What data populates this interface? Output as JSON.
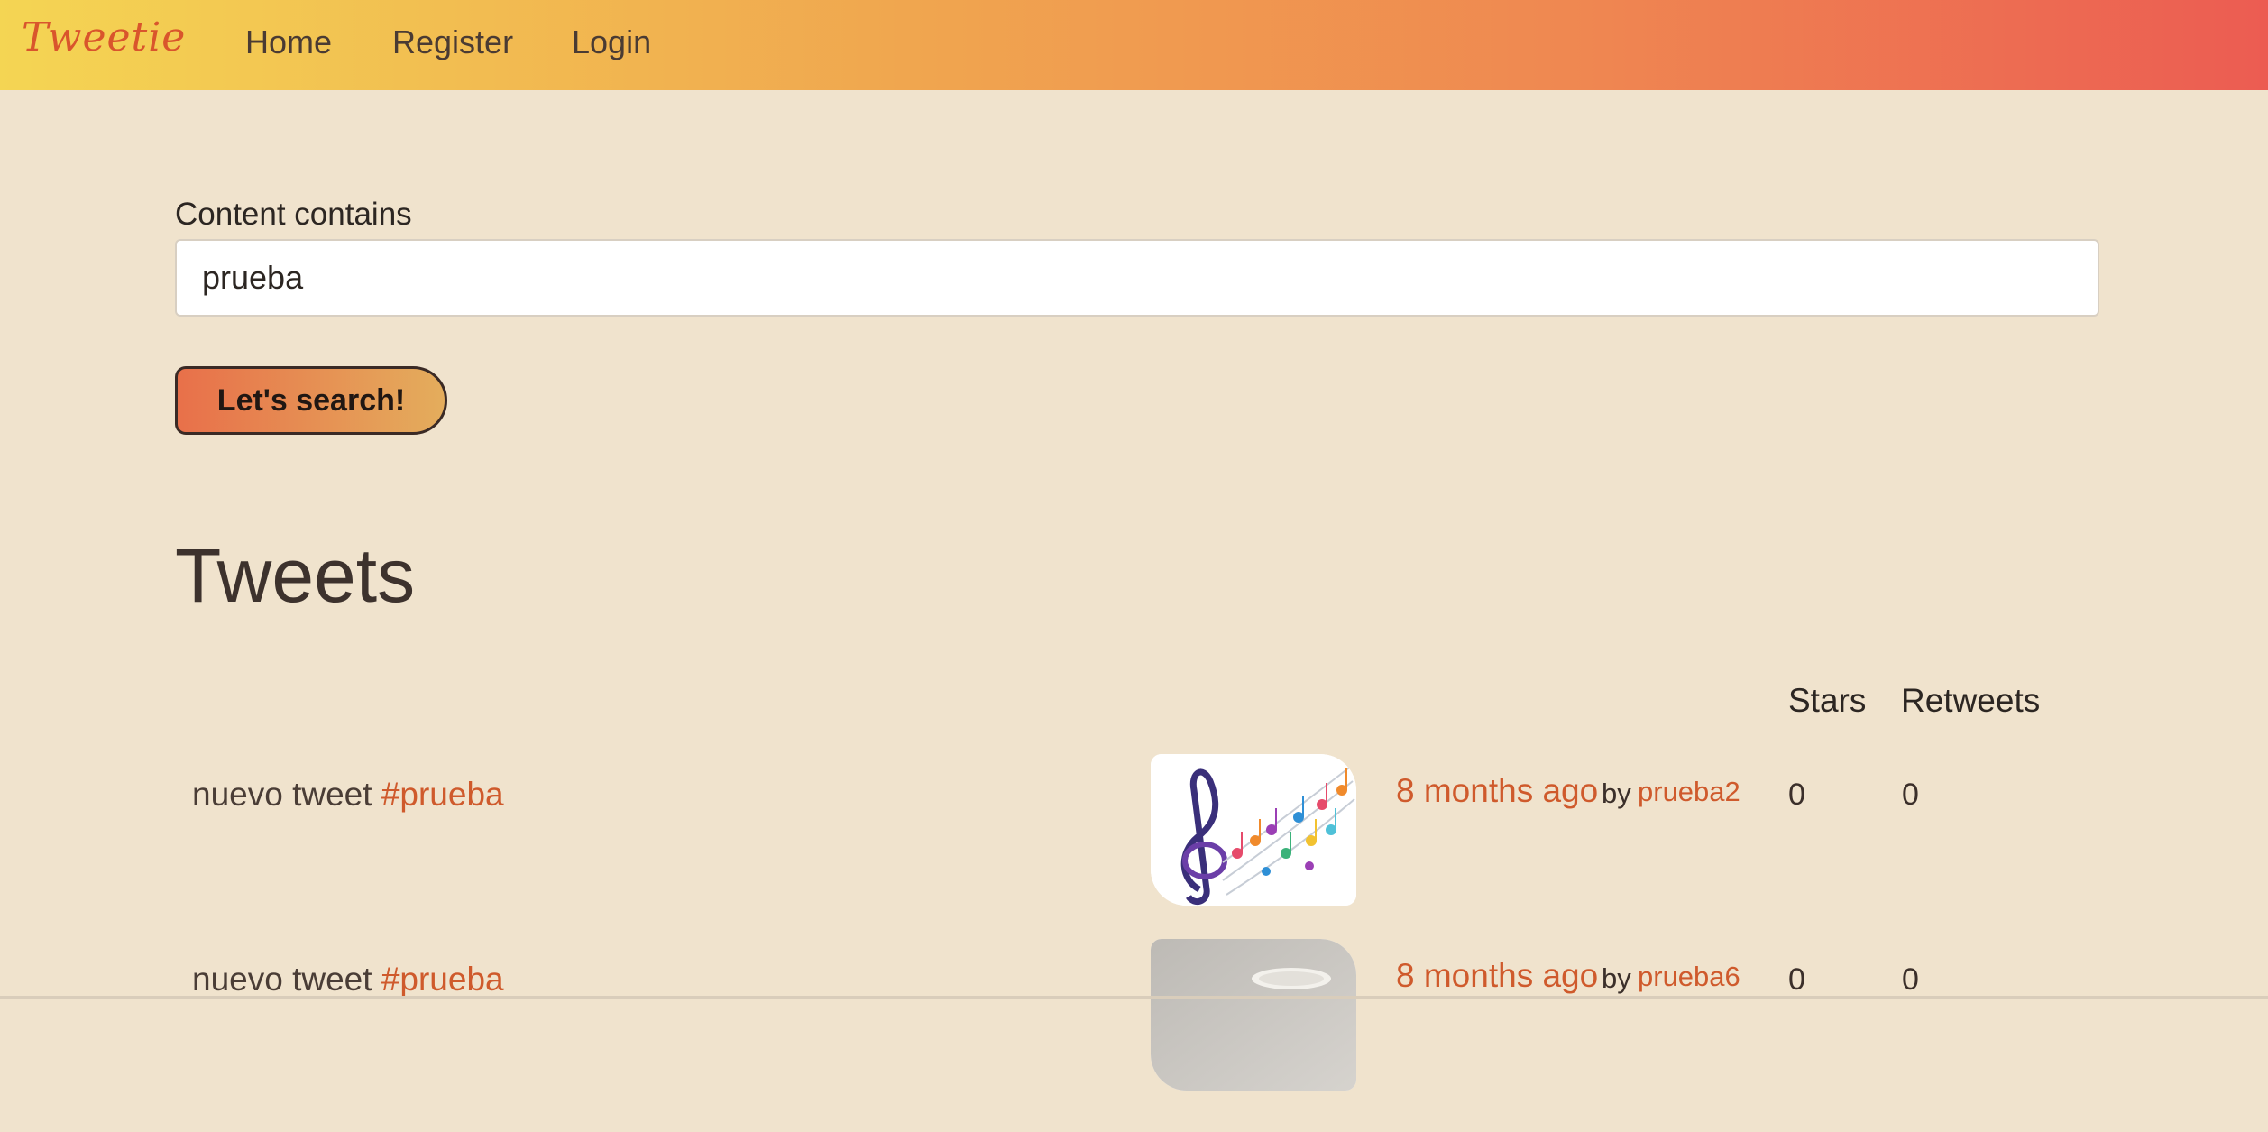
{
  "navbar": {
    "brand": "Tweetie",
    "links": [
      "Home",
      "Register",
      "Login"
    ]
  },
  "search": {
    "label": "Content contains",
    "value": "prueba",
    "button_label": "Let's search!"
  },
  "tweets_section": {
    "title": "Tweets",
    "columns": {
      "stars": "Stars",
      "retweets": "Retweets"
    },
    "rows": [
      {
        "text": "nuevo tweet",
        "hashtag": "#prueba",
        "image": "music-notes-image",
        "time": "8 months ago",
        "by": "by",
        "user": "prueba2",
        "stars": "0",
        "retweets": "0"
      },
      {
        "text": "nuevo tweet",
        "hashtag": "#prueba",
        "image": "mug-image",
        "time": "8 months ago",
        "by": "by",
        "user": "prueba6",
        "stars": "0",
        "retweets": "0"
      }
    ]
  },
  "colors": {
    "accent": "#cf5a2c",
    "background": "#f0e3cd",
    "navbar_gradient": [
      "#f4d553",
      "#ec5c52"
    ]
  }
}
